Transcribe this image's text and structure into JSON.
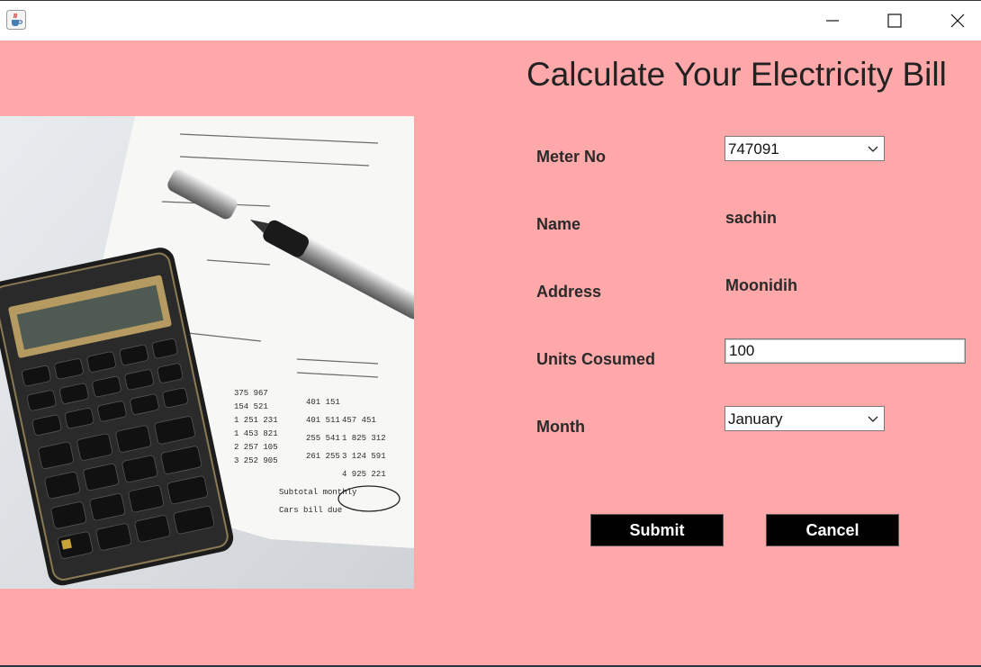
{
  "window": {
    "icon": "java-cup-icon",
    "controls": [
      "minimize-icon",
      "maximize-icon",
      "close-icon"
    ]
  },
  "header": {
    "title": "Calculate Your Electricity Bill"
  },
  "image": {
    "subject": "calculator-and-bill-photo"
  },
  "form": {
    "meter_no": {
      "label": "Meter No",
      "value": "747091"
    },
    "name": {
      "label": "Name",
      "value": "sachin"
    },
    "address": {
      "label": "Address",
      "value": "Moonidih"
    },
    "units": {
      "label": "Units Cosumed",
      "value": "100"
    },
    "month": {
      "label": "Month",
      "value": "January"
    }
  },
  "buttons": {
    "submit": "Submit",
    "cancel": "Cancel"
  },
  "colors": {
    "background": "#ffa8aa",
    "button": "#000000",
    "button_text": "#ffffff"
  }
}
